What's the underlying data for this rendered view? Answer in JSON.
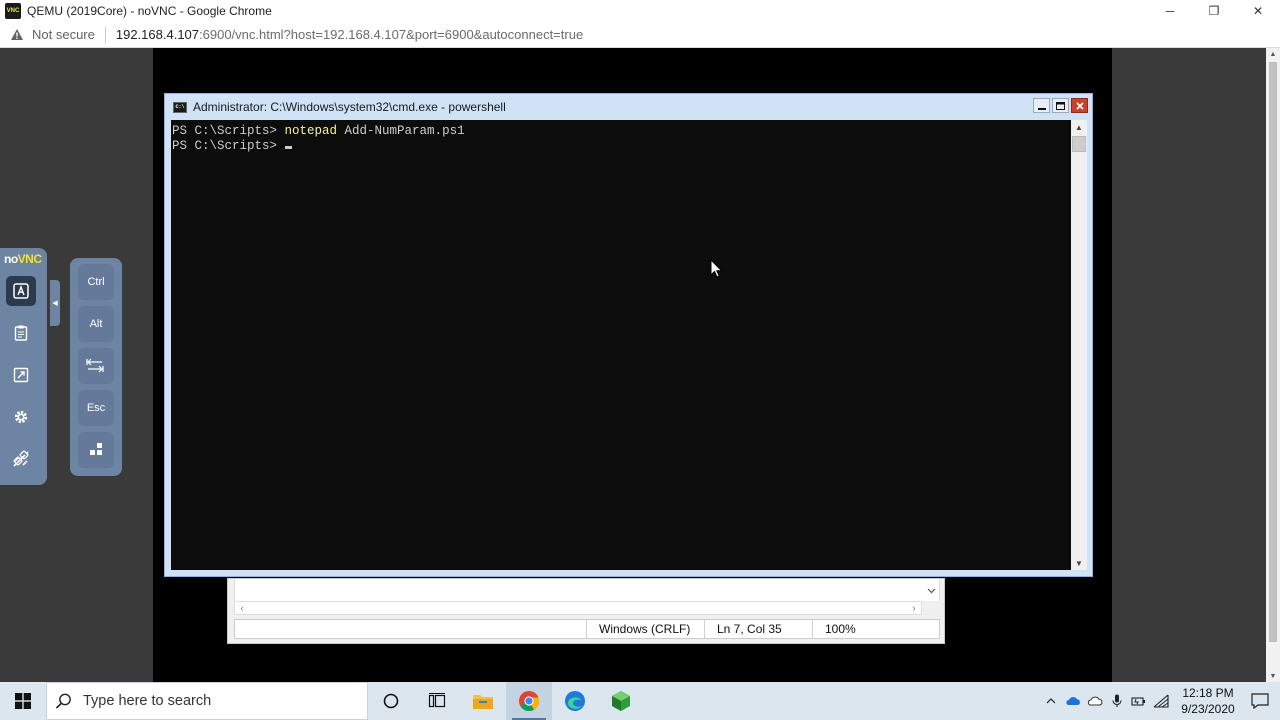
{
  "browser": {
    "window_title": "QEMU (2019Core) - noVNC - Google Chrome",
    "app_icon_text": "VNC",
    "security_label": "Not secure",
    "url_host": "192.168.4.107",
    "url_rest": ":6900/vnc.html?host=192.168.4.107&port=6900&autoconnect=true",
    "controls": {
      "minimize": "─",
      "restore": "❐",
      "close": "✕"
    }
  },
  "cmd_window": {
    "title": "Administrator: C:\\Windows\\system32\\cmd.exe - powershell",
    "icon_text": "C:\\",
    "lines": [
      {
        "prompt": "PS C:\\Scripts> ",
        "command": "notepad",
        "args": " Add-NumParam.ps1"
      },
      {
        "prompt": "PS C:\\Scripts> ",
        "command": "",
        "args": ""
      }
    ]
  },
  "notepad": {
    "status_line_ending": "Windows (CRLF)",
    "status_position": "Ln 7, Col 35",
    "status_zoom": "100%"
  },
  "novnc": {
    "logo_no": "no",
    "logo_vnc": "VNC",
    "extra_keys": {
      "ctrl": "Ctrl",
      "alt": "Alt",
      "esc": "Esc"
    }
  },
  "taskbar": {
    "search_placeholder": "Type here to search",
    "clock_time": "12:18 PM",
    "clock_date": "9/23/2020"
  }
}
